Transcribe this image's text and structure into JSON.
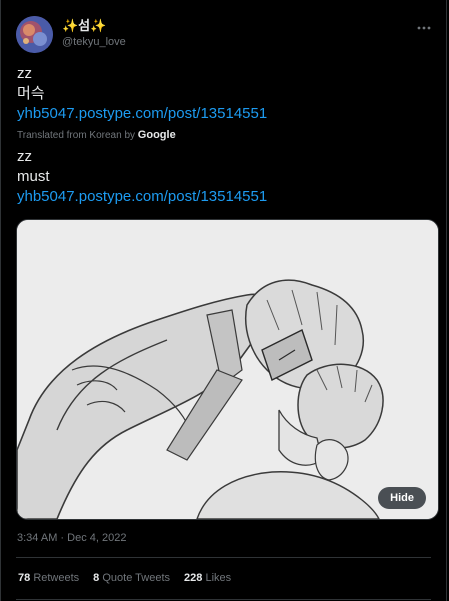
{
  "author": {
    "display_name": "✨섬✨",
    "handle": "@tekyu_love",
    "avatar_icon": "avatar-image"
  },
  "tweet": {
    "original_line1": "zz",
    "original_line2": "머슥",
    "original_link": "yhb5047.postype.com/post/13514551",
    "translation_prefix": "Translated from Korean by ",
    "translation_provider": "Google",
    "translated_line1": "zz",
    "translated_line2": "must",
    "translated_link": "yhb5047.postype.com/post/13514551"
  },
  "media": {
    "hide_label": "Hide"
  },
  "timestamp": "3:34 AM · Dec 4, 2022",
  "stats": {
    "retweets_count": "78",
    "retweets_label": "Retweets",
    "quotes_count": "8",
    "quotes_label": "Quote Tweets",
    "likes_count": "228",
    "likes_label": "Likes"
  },
  "colors": {
    "background": "#000000",
    "text": "#e7e9ea",
    "muted": "#71767b",
    "link": "#1d9bf0",
    "divider": "#2f3336"
  },
  "icons": [
    "more-icon"
  ]
}
